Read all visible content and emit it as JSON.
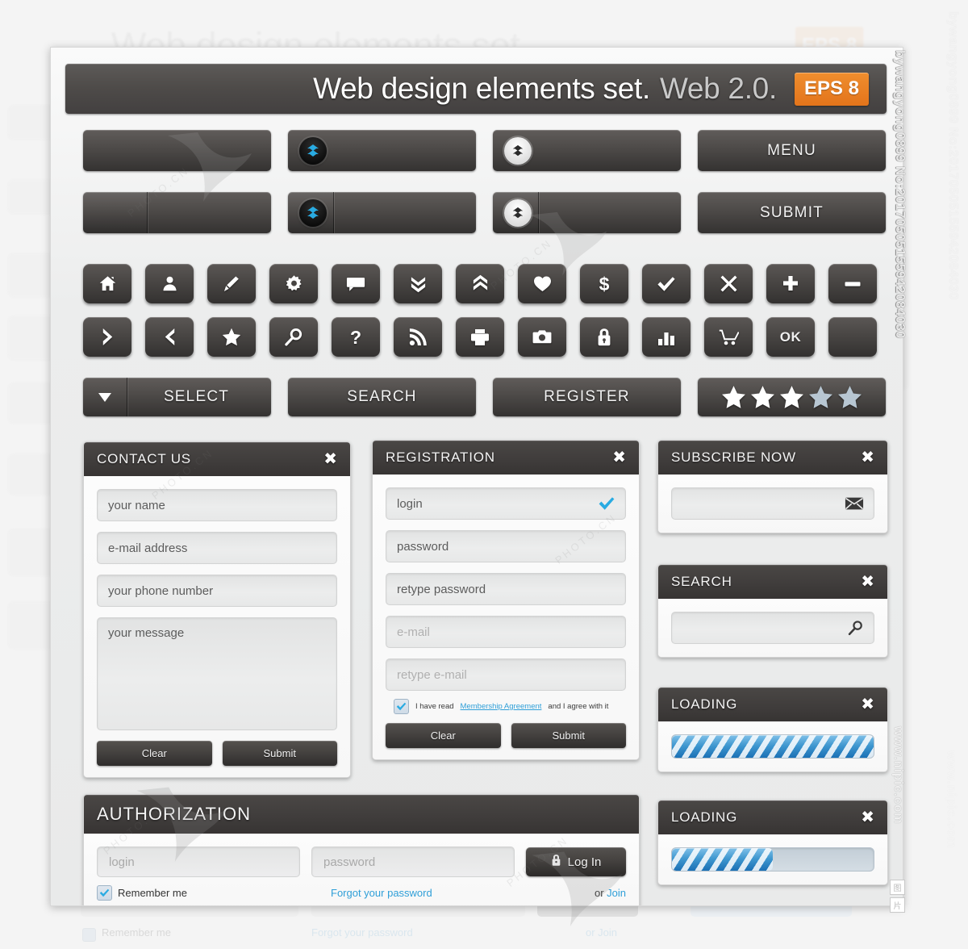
{
  "header": {
    "title_primary": "Web design elements set.",
    "title_secondary": "Web 2.0.",
    "badge": "EPS 8"
  },
  "big_buttons": {
    "row1": [
      {
        "name": "plain-button",
        "label": "",
        "icon": "none",
        "split": false
      },
      {
        "name": "dropdown-button-blue",
        "label": "",
        "icon": "double-chevron-down-blue",
        "split": false
      },
      {
        "name": "dropdown-button-light",
        "label": "",
        "icon": "double-chevron-down-dark",
        "split": false
      },
      {
        "name": "menu-button",
        "label": "MENU",
        "icon": "none",
        "split": false
      }
    ],
    "row2": [
      {
        "name": "split-button",
        "label": "",
        "icon": "none",
        "split": true
      },
      {
        "name": "split-dropdown-blue",
        "label": "",
        "icon": "double-chevron-down-blue",
        "split": true
      },
      {
        "name": "split-dropdown-light",
        "label": "",
        "icon": "double-chevron-down-dark",
        "split": true
      },
      {
        "name": "submit-button",
        "label": "SUBMIT",
        "icon": "none",
        "split": false
      }
    ]
  },
  "icon_buttons": {
    "row1": [
      {
        "name": "home-icon",
        "label": ""
      },
      {
        "name": "user-icon",
        "label": ""
      },
      {
        "name": "pencil-icon",
        "label": ""
      },
      {
        "name": "gear-icon",
        "label": ""
      },
      {
        "name": "comment-icon",
        "label": ""
      },
      {
        "name": "double-chevron-down-icon",
        "label": ""
      },
      {
        "name": "double-chevron-up-icon",
        "label": ""
      },
      {
        "name": "heart-icon",
        "label": ""
      },
      {
        "name": "dollar-icon",
        "label": ""
      },
      {
        "name": "check-icon",
        "label": ""
      },
      {
        "name": "close-icon",
        "label": ""
      },
      {
        "name": "plus-icon",
        "label": ""
      },
      {
        "name": "minus-icon",
        "label": ""
      }
    ],
    "row2": [
      {
        "name": "chevron-right-icon",
        "label": ""
      },
      {
        "name": "chevron-left-icon",
        "label": ""
      },
      {
        "name": "star-icon",
        "label": ""
      },
      {
        "name": "search-icon",
        "label": ""
      },
      {
        "name": "question-icon",
        "label": ""
      },
      {
        "name": "rss-icon",
        "label": ""
      },
      {
        "name": "printer-icon",
        "label": ""
      },
      {
        "name": "camera-icon",
        "label": ""
      },
      {
        "name": "lock-icon",
        "label": ""
      },
      {
        "name": "bar-chart-icon",
        "label": ""
      },
      {
        "name": "cart-icon",
        "label": ""
      },
      {
        "name": "ok-text",
        "label": "OK"
      },
      {
        "name": "blank-button",
        "label": ""
      }
    ]
  },
  "wide_buttons": {
    "select": "SELECT",
    "search": "SEARCH",
    "register": "REGISTER",
    "rating": {
      "filled": 3,
      "total": 5
    }
  },
  "contact_panel": {
    "title": "CONTACT US",
    "close": "✖",
    "fields": [
      {
        "name": "name-field",
        "value": "your name"
      },
      {
        "name": "email-field",
        "value": "e-mail address"
      },
      {
        "name": "phone-field",
        "value": "your phone number"
      },
      {
        "name": "message-field",
        "value": "your message"
      }
    ],
    "clear": "Clear",
    "submit": "Submit"
  },
  "registration_panel": {
    "title": "REGISTRATION",
    "close": "✖",
    "fields": [
      {
        "name": "login-field",
        "value": "login",
        "valid": true
      },
      {
        "name": "password-field",
        "value": "password",
        "valid": false
      },
      {
        "name": "retype-password-field",
        "value": "retype password",
        "valid": false
      },
      {
        "name": "email-field",
        "value": "e-mail",
        "valid": false,
        "muted": true
      },
      {
        "name": "retype-email-field",
        "value": "retype e-mail",
        "valid": false,
        "muted": true
      }
    ],
    "agreement": {
      "checked": true,
      "pre": "I have read",
      "link": "Membership Agreement",
      "post": "and I agree with it"
    },
    "clear": "Clear",
    "submit": "Submit"
  },
  "subscribe_panel": {
    "title": "SUBSCRIBE NOW",
    "close": "✖",
    "input_value": "",
    "icon": "envelope-icon"
  },
  "search_panel": {
    "title": "SEARCH",
    "close": "✖",
    "input_value": "",
    "icon": "search-icon"
  },
  "loading_panels": [
    {
      "title": "LOADING",
      "close": "✖",
      "progress": 100
    },
    {
      "title": "LOADING",
      "close": "✖",
      "progress": 50
    }
  ],
  "authorization_panel": {
    "title": "AUTHORIZATION",
    "login_placeholder": "login",
    "password_placeholder": "password",
    "login_button": "Log In",
    "login_icon": "lock-icon",
    "remember_label": "Remember me",
    "remember_checked": true,
    "forgot_link": "Forgot your password",
    "or_text": "or ",
    "join_link": "Join"
  },
  "watermarks": {
    "vertical_id": "bywangyong0899 No:20170505155942084030",
    "site": "www.nipic.com",
    "diagonal": "PHOTO.CN"
  },
  "colors": {
    "accent_orange": "#e3741b",
    "accent_blue": "#29abe2",
    "link_blue": "#2f9fd8",
    "dark_panel": "#403d3c",
    "button_dark": "#4a4745",
    "page_bg": "#ececec"
  }
}
